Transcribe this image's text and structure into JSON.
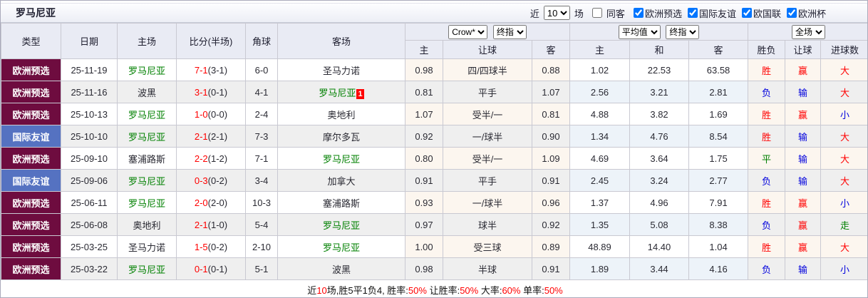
{
  "title": "罗马尼亚",
  "toolbar": {
    "recent_prefix": "近",
    "recent_value": "10",
    "recent_suffix": "场",
    "same_away": {
      "label": "同客",
      "checked": false
    },
    "competitions": [
      {
        "label": "欧洲预选",
        "checked": true
      },
      {
        "label": "国际友谊",
        "checked": true
      },
      {
        "label": "欧国联",
        "checked": true
      },
      {
        "label": "欧洲杯",
        "checked": true
      }
    ]
  },
  "table": {
    "columns": {
      "type": "类型",
      "date": "日期",
      "home": "主场",
      "score": "比分(半场)",
      "corner": "角球",
      "away": "客场",
      "odds_home": "主",
      "odds_handicap": "让球",
      "odds_away": "客",
      "avg_home": "主",
      "avg_draw": "和",
      "avg_away": "客",
      "result": "胜负",
      "handicap_result": "让球",
      "goals": "进球数"
    },
    "selectors": {
      "company": "Crow*",
      "company_stage": "终指",
      "average": "平均值",
      "average_stage": "终指",
      "period": "全场"
    }
  },
  "colors": {
    "league_euro_qualifier": "#6e0c3f",
    "league_friendly": "#5572c1",
    "win_red": "#ff0000",
    "loss_blue": "#0000dd",
    "draw_green": "#008000",
    "team_green": "#008000"
  },
  "rows": [
    {
      "type": "欧洲预选",
      "type_bg": "#6e0c3f",
      "date": "25-11-19",
      "home": "罗马尼亚",
      "home_color": "#008000",
      "score": "7-1",
      "half": "(3-1)",
      "corner": "6-0",
      "away": "圣马力诺",
      "away_color": "#2a2a33",
      "away_badge": "",
      "odds_home": "0.98",
      "handicap": "四/四球半",
      "odds_away": "0.88",
      "avg_home": "1.02",
      "avg_draw": "22.53",
      "avg_away": "63.58",
      "result": "胜",
      "result_color": "#ff0000",
      "let_result": "赢",
      "let_color": "#ff0000",
      "goals": "大",
      "goals_color": "#ff0000"
    },
    {
      "type": "欧洲预选",
      "type_bg": "#6e0c3f",
      "date": "25-11-16",
      "home": "波黑",
      "home_color": "#2a2a33",
      "score": "3-1",
      "half": "(0-1)",
      "corner": "4-1",
      "away": "罗马尼亚",
      "away_color": "#008000",
      "away_badge": "1",
      "odds_home": "0.81",
      "handicap": "平手",
      "odds_away": "1.07",
      "avg_home": "2.56",
      "avg_draw": "3.21",
      "avg_away": "2.81",
      "result": "负",
      "result_color": "#0000dd",
      "let_result": "输",
      "let_color": "#0000dd",
      "goals": "大",
      "goals_color": "#ff0000"
    },
    {
      "type": "欧洲预选",
      "type_bg": "#6e0c3f",
      "date": "25-10-13",
      "home": "罗马尼亚",
      "home_color": "#008000",
      "score": "1-0",
      "half": "(0-0)",
      "corner": "2-4",
      "away": "奥地利",
      "away_color": "#2a2a33",
      "away_badge": "",
      "odds_home": "1.07",
      "handicap": "受半/一",
      "odds_away": "0.81",
      "avg_home": "4.88",
      "avg_draw": "3.82",
      "avg_away": "1.69",
      "result": "胜",
      "result_color": "#ff0000",
      "let_result": "赢",
      "let_color": "#ff0000",
      "goals": "小",
      "goals_color": "#0000dd"
    },
    {
      "type": "国际友谊",
      "type_bg": "#5572c1",
      "date": "25-10-10",
      "home": "罗马尼亚",
      "home_color": "#008000",
      "score": "2-1",
      "half": "(2-1)",
      "corner": "7-3",
      "away": "摩尔多瓦",
      "away_color": "#2a2a33",
      "away_badge": "",
      "odds_home": "0.92",
      "handicap": "一/球半",
      "odds_away": "0.90",
      "avg_home": "1.34",
      "avg_draw": "4.76",
      "avg_away": "8.54",
      "result": "胜",
      "result_color": "#ff0000",
      "let_result": "输",
      "let_color": "#0000dd",
      "goals": "大",
      "goals_color": "#ff0000"
    },
    {
      "type": "欧洲预选",
      "type_bg": "#6e0c3f",
      "date": "25-09-10",
      "home": "塞浦路斯",
      "home_color": "#2a2a33",
      "score": "2-2",
      "half": "(1-2)",
      "corner": "7-1",
      "away": "罗马尼亚",
      "away_color": "#008000",
      "away_badge": "",
      "odds_home": "0.80",
      "handicap": "受半/一",
      "odds_away": "1.09",
      "avg_home": "4.69",
      "avg_draw": "3.64",
      "avg_away": "1.75",
      "result": "平",
      "result_color": "#008000",
      "let_result": "输",
      "let_color": "#0000dd",
      "goals": "大",
      "goals_color": "#ff0000"
    },
    {
      "type": "国际友谊",
      "type_bg": "#5572c1",
      "date": "25-09-06",
      "home": "罗马尼亚",
      "home_color": "#008000",
      "score": "0-3",
      "half": "(0-2)",
      "corner": "3-4",
      "away": "加拿大",
      "away_color": "#2a2a33",
      "away_badge": "",
      "odds_home": "0.91",
      "handicap": "平手",
      "odds_away": "0.91",
      "avg_home": "2.45",
      "avg_draw": "3.24",
      "avg_away": "2.77",
      "result": "负",
      "result_color": "#0000dd",
      "let_result": "输",
      "let_color": "#0000dd",
      "goals": "大",
      "goals_color": "#ff0000"
    },
    {
      "type": "欧洲预选",
      "type_bg": "#6e0c3f",
      "date": "25-06-11",
      "home": "罗马尼亚",
      "home_color": "#008000",
      "score": "2-0",
      "half": "(2-0)",
      "corner": "10-3",
      "away": "塞浦路斯",
      "away_color": "#2a2a33",
      "away_badge": "",
      "odds_home": "0.93",
      "handicap": "一/球半",
      "odds_away": "0.96",
      "avg_home": "1.37",
      "avg_draw": "4.96",
      "avg_away": "7.91",
      "result": "胜",
      "result_color": "#ff0000",
      "let_result": "赢",
      "let_color": "#ff0000",
      "goals": "小",
      "goals_color": "#0000dd"
    },
    {
      "type": "欧洲预选",
      "type_bg": "#6e0c3f",
      "date": "25-06-08",
      "home": "奥地利",
      "home_color": "#2a2a33",
      "score": "2-1",
      "half": "(1-0)",
      "corner": "5-4",
      "away": "罗马尼亚",
      "away_color": "#008000",
      "away_badge": "",
      "odds_home": "0.97",
      "handicap": "球半",
      "odds_away": "0.92",
      "avg_home": "1.35",
      "avg_draw": "5.08",
      "avg_away": "8.38",
      "result": "负",
      "result_color": "#0000dd",
      "let_result": "赢",
      "let_color": "#ff0000",
      "goals": "走",
      "goals_color": "#008000"
    },
    {
      "type": "欧洲预选",
      "type_bg": "#6e0c3f",
      "date": "25-03-25",
      "home": "圣马力诺",
      "home_color": "#2a2a33",
      "score": "1-5",
      "half": "(0-2)",
      "corner": "2-10",
      "away": "罗马尼亚",
      "away_color": "#008000",
      "away_badge": "",
      "odds_home": "1.00",
      "handicap": "受三球",
      "odds_away": "0.89",
      "avg_home": "48.89",
      "avg_draw": "14.40",
      "avg_away": "1.04",
      "result": "胜",
      "result_color": "#ff0000",
      "let_result": "赢",
      "let_color": "#ff0000",
      "goals": "大",
      "goals_color": "#ff0000"
    },
    {
      "type": "欧洲预选",
      "type_bg": "#6e0c3f",
      "date": "25-03-22",
      "home": "罗马尼亚",
      "home_color": "#008000",
      "score": "0-1",
      "half": "(0-1)",
      "corner": "5-1",
      "away": "波黑",
      "away_color": "#2a2a33",
      "away_badge": "",
      "odds_home": "0.98",
      "handicap": "半球",
      "odds_away": "0.91",
      "avg_home": "1.89",
      "avg_draw": "3.44",
      "avg_away": "4.16",
      "result": "负",
      "result_color": "#0000dd",
      "let_result": "输",
      "let_color": "#0000dd",
      "goals": "小",
      "goals_color": "#0000dd"
    }
  ],
  "footer": {
    "parts": [
      {
        "text": "近",
        "red": false
      },
      {
        "text": "10",
        "red": true
      },
      {
        "text": "场,胜5平1负4, 胜率:",
        "red": false
      },
      {
        "text": "50%",
        "red": true
      },
      {
        "text": " 让胜率:",
        "red": false
      },
      {
        "text": "50%",
        "red": true
      },
      {
        "text": " 大率:",
        "red": false
      },
      {
        "text": "60%",
        "red": true
      },
      {
        "text": " 单率:",
        "red": false
      },
      {
        "text": "50%",
        "red": true
      }
    ]
  }
}
